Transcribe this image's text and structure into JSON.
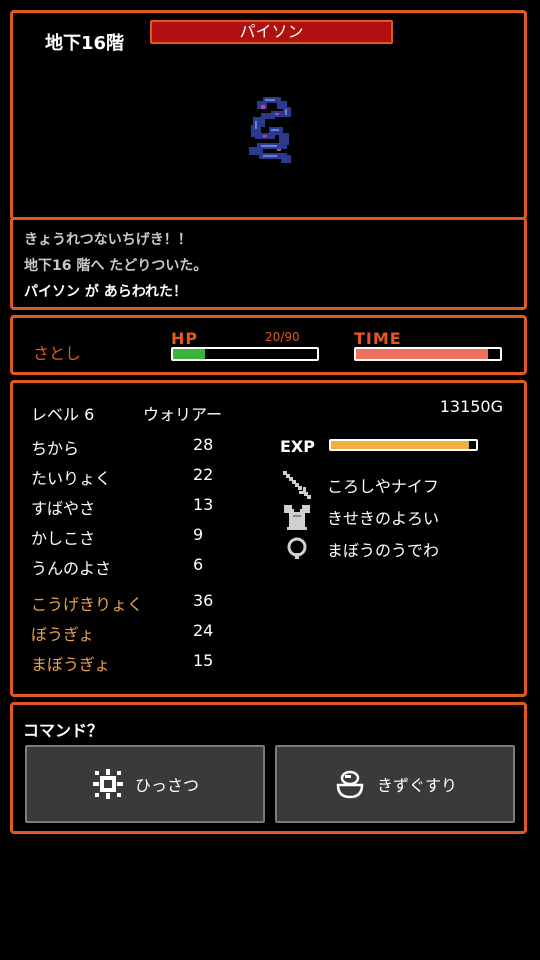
{
  "battle": {
    "floor": "地下16階",
    "enemy_name": "パイソン"
  },
  "log": {
    "lines": [
      "きょうれつないちげき！！",
      "地下16 階へ たどりついた。",
      "パイソン が あらわれた！"
    ]
  },
  "status": {
    "player_name": "さとし",
    "hp_label": "HP",
    "hp_value": "20/90",
    "hp_current": 20,
    "hp_max": 90,
    "time_label": "TIME",
    "time_fraction": 0.92,
    "colors": {
      "hp": "#3cb33c",
      "time": "#f07060",
      "accent": "#e2591f"
    }
  },
  "stats": {
    "level": "レベル 6",
    "job": "ウォリアー",
    "gold": "13150G",
    "exp_label": "EXP",
    "exp_fraction": 0.95,
    "exp_color": "#f0b040",
    "base": [
      {
        "label": "ちから",
        "value": "28"
      },
      {
        "label": "たいりょく",
        "value": "22"
      },
      {
        "label": "すばやさ",
        "value": "13"
      },
      {
        "label": "かしこさ",
        "value": "9"
      },
      {
        "label": "うんのよさ",
        "value": "6"
      }
    ],
    "combat": [
      {
        "label": "こうげきりょく",
        "value": "36"
      },
      {
        "label": "ぼうぎょ",
        "value": "24"
      },
      {
        "label": "まぼうぎょ",
        "value": "15"
      }
    ],
    "equipment": [
      {
        "icon": "knife-icon",
        "name": "ころしやナイフ"
      },
      {
        "icon": "armor-icon",
        "name": "きせきのよろい"
      },
      {
        "icon": "bracelet-icon",
        "name": "まぼうのうでわ"
      }
    ]
  },
  "command": {
    "prompt": "コマンド？",
    "buttons": [
      {
        "icon": "special-attack-icon",
        "label": "ひっさつ"
      },
      {
        "icon": "potion-icon",
        "label": "きずぐすり"
      }
    ]
  }
}
